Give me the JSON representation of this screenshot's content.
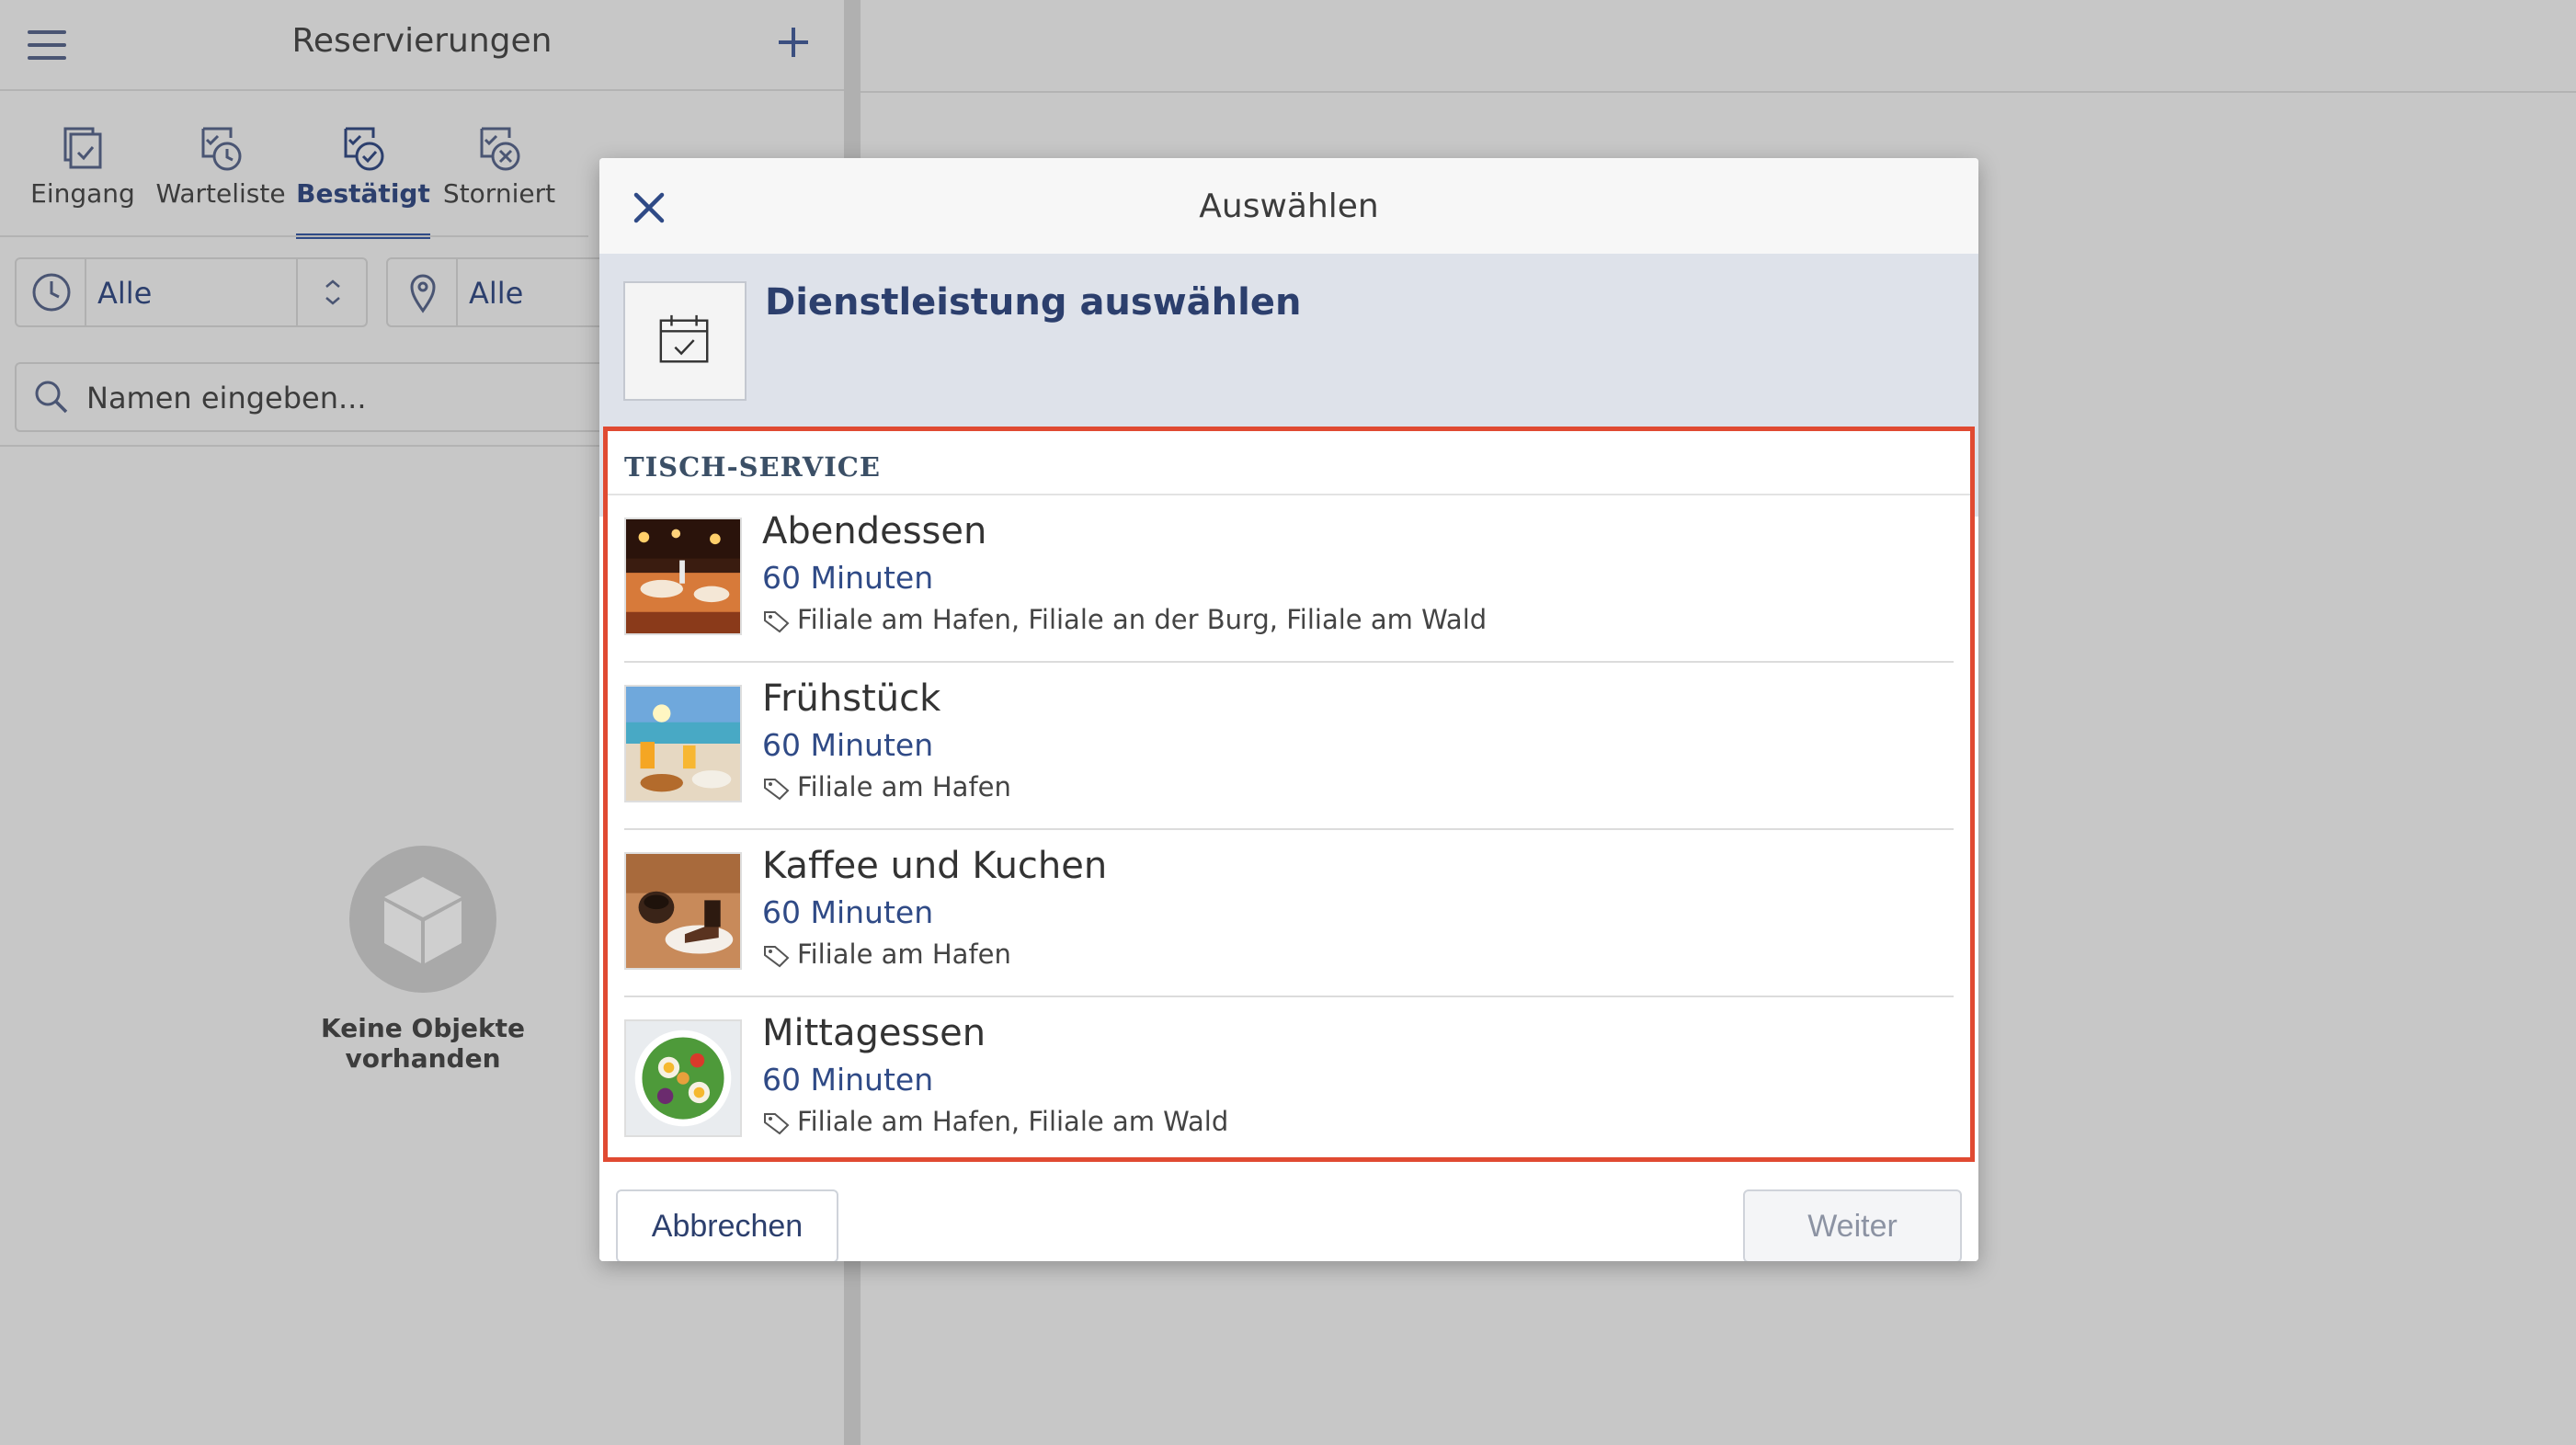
{
  "left_panel": {
    "title": "Reservierungen",
    "tabs": [
      {
        "label": "Eingang"
      },
      {
        "label": "Warteliste"
      },
      {
        "label": "Bestätigt"
      },
      {
        "label": "Storniert"
      }
    ],
    "active_tab": "Bestätigt",
    "filters": {
      "time_value": "Alle",
      "location_value": "Alle"
    },
    "search": {
      "placeholder": "Namen eingeben..."
    },
    "empty_state": {
      "text": "Keine Objekte vorhanden"
    }
  },
  "modal": {
    "title": "Auswählen",
    "band_title": "Dienstleistung auswählen",
    "section_label": "TISCH-SERVICE",
    "services": [
      {
        "name": "Abendessen",
        "duration": "60 Minuten",
        "branches": "Filiale am Hafen, Filiale an der Burg, Filiale am Wald"
      },
      {
        "name": "Frühstück",
        "duration": "60 Minuten",
        "branches": "Filiale am Hafen"
      },
      {
        "name": "Kaffee und Kuchen",
        "duration": "60 Minuten",
        "branches": "Filiale am Hafen"
      },
      {
        "name": "Mittagessen",
        "duration": "60 Minuten",
        "branches": "Filiale am Hafen, Filiale am Wald"
      }
    ],
    "cancel_label": "Abbrechen",
    "next_label": "Weiter"
  },
  "colors": {
    "accent": "#2f4a86",
    "highlight_frame": "#e04a32",
    "backdrop": "#c7c7c7",
    "band": "#dee2ea"
  }
}
